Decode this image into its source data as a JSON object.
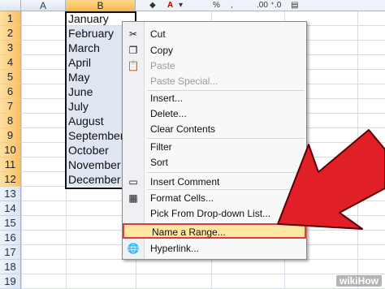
{
  "columns": [
    {
      "label": "A",
      "selected": false
    },
    {
      "label": "B",
      "selected": true
    }
  ],
  "rows": [
    {
      "num": "1",
      "value": "January"
    },
    {
      "num": "2",
      "value": "February"
    },
    {
      "num": "3",
      "value": "March"
    },
    {
      "num": "4",
      "value": "April"
    },
    {
      "num": "5",
      "value": "May"
    },
    {
      "num": "6",
      "value": "June"
    },
    {
      "num": "7",
      "value": "July"
    },
    {
      "num": "8",
      "value": "August"
    },
    {
      "num": "9",
      "value": "September"
    },
    {
      "num": "10",
      "value": "October"
    },
    {
      "num": "11",
      "value": "November"
    },
    {
      "num": "12",
      "value": "December"
    },
    {
      "num": "13",
      "value": ""
    },
    {
      "num": "14",
      "value": ""
    },
    {
      "num": "15",
      "value": ""
    },
    {
      "num": "16",
      "value": ""
    },
    {
      "num": "17",
      "value": ""
    },
    {
      "num": "18",
      "value": ""
    },
    {
      "num": "19",
      "value": ""
    }
  ],
  "ribbon": {
    "font_color_label": "A",
    "percent_label": "%",
    "comma_label": ",",
    "decimals_label": ".00 ⁺.0"
  },
  "menu": {
    "items": [
      {
        "label": "Cut",
        "icon": "scissors-icon",
        "glyph": "✂",
        "disabled": false
      },
      {
        "label": "Copy",
        "icon": "copy-icon",
        "glyph": "❐",
        "disabled": false
      },
      {
        "label": "Paste",
        "icon": "paste-icon",
        "glyph": "📋",
        "disabled": true
      },
      {
        "label": "Paste Special...",
        "icon": "",
        "glyph": "",
        "disabled": true
      },
      {
        "label": "Insert...",
        "icon": "",
        "glyph": "",
        "disabled": false
      },
      {
        "label": "Delete...",
        "icon": "",
        "glyph": "",
        "disabled": false
      },
      {
        "label": "Clear Contents",
        "icon": "",
        "glyph": "",
        "disabled": false
      },
      {
        "label": "Filter",
        "icon": "",
        "glyph": "",
        "disabled": false
      },
      {
        "label": "Sort",
        "icon": "",
        "glyph": "",
        "disabled": false
      },
      {
        "label": "Insert Comment",
        "icon": "comment-icon",
        "glyph": "▭",
        "disabled": false
      },
      {
        "label": "Format Cells...",
        "icon": "format-cells-icon",
        "glyph": "▦",
        "disabled": false
      },
      {
        "label": "Pick From Drop-down List...",
        "icon": "",
        "glyph": "",
        "disabled": false
      },
      {
        "label": "Name a Range...",
        "icon": "",
        "glyph": "",
        "disabled": false,
        "highlighted": true
      },
      {
        "label": "Hyperlink...",
        "icon": "hyperlink-icon",
        "glyph": "🌐",
        "disabled": false
      }
    ]
  },
  "colors": {
    "highlight_border": "#e23a3a",
    "arrow": "#e01f26",
    "highlight_fill": "#fde7a3"
  },
  "watermark": "wikiHow"
}
